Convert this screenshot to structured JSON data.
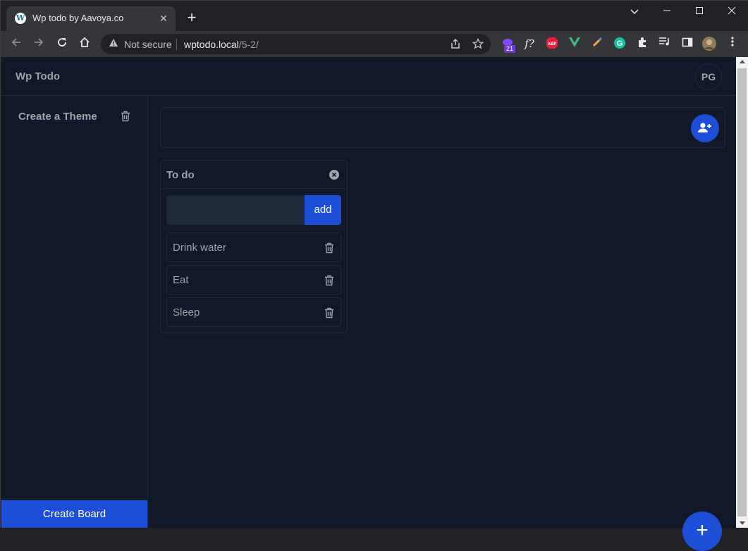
{
  "browser": {
    "tab_title": "Wp todo by Aavoya.co",
    "tab_favicon": "wordpress-icon",
    "new_tab_symbol": "+",
    "close_tab_symbol": "✕",
    "security_label": "Not secure",
    "url_host": "wptodo.local",
    "url_path": "/5-2/",
    "extension_badge": "21",
    "extensions": [
      "weather-extension-icon",
      "fonts-extension-icon",
      "adblock-icon",
      "vue-devtools-icon",
      "color-picker-icon",
      "grammarly-icon",
      "extensions-puzzle-icon",
      "media-queue-icon",
      "side-panel-icon",
      "profile-avatar"
    ]
  },
  "app": {
    "title": "Wp Todo",
    "user_initials": "PG",
    "accent_color": "#1d4ed8",
    "background_color": "#111827"
  },
  "sidebar": {
    "themes": [
      {
        "label": "Create a Theme"
      }
    ],
    "create_board_label": "Create Board"
  },
  "board": {
    "lists": [
      {
        "title": "To do",
        "input_value": "",
        "add_label": "add",
        "items": [
          {
            "label": "Drink water"
          },
          {
            "label": "Eat"
          },
          {
            "label": "Sleep"
          }
        ]
      }
    ],
    "fab_symbol": "+"
  }
}
